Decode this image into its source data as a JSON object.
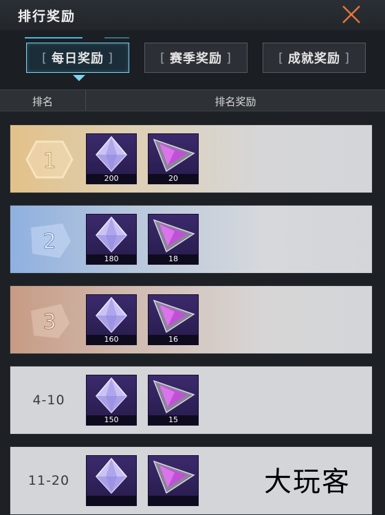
{
  "header": {
    "title": "排行奖励"
  },
  "tabs": [
    {
      "label": "每日奖励",
      "active": true
    },
    {
      "label": "赛季奖励",
      "active": false
    },
    {
      "label": "成就奖励",
      "active": false
    }
  ],
  "columns": {
    "rank": "排名",
    "reward": "排名奖励"
  },
  "rows": [
    {
      "rank": "1",
      "style": "gold",
      "gem_qty": "200",
      "shard_qty": "20"
    },
    {
      "rank": "2",
      "style": "silver",
      "gem_qty": "180",
      "shard_qty": "18"
    },
    {
      "rank": "3",
      "style": "bronze",
      "gem_qty": "160",
      "shard_qty": "16"
    },
    {
      "rank": "4-10",
      "style": "plain",
      "gem_qty": "150",
      "shard_qty": "15"
    },
    {
      "rank": "11-20",
      "style": "plain",
      "gem_qty": "",
      "shard_qty": ""
    }
  ],
  "watermark": "大玩客",
  "colors": {
    "accent": "#7fd3ef",
    "close": "#e8753a",
    "gold": "#e2c189",
    "silver": "#8fb0e0",
    "bronze": "#c79b84",
    "item_bg": "#3b2a6c"
  }
}
